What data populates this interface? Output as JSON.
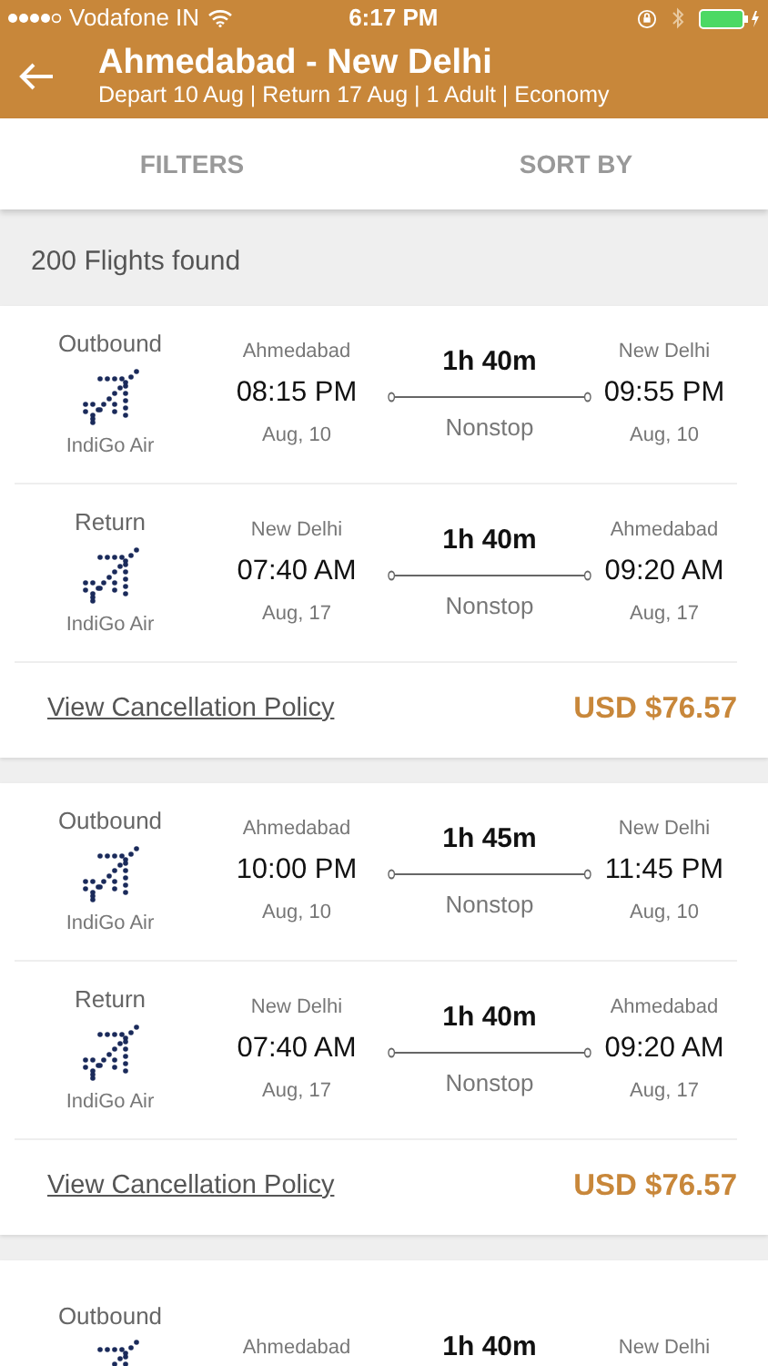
{
  "status_bar": {
    "carrier": "Vodafone IN",
    "time": "6:17 PM"
  },
  "header": {
    "title": "Ahmedabad -  New Delhi",
    "subtitle": "Depart 10 Aug | Return 17 Aug | 1 Adult | Economy"
  },
  "tabs": [
    {
      "label": "FILTERS"
    },
    {
      "label": "SORT BY"
    }
  ],
  "results_count": "200 Flights found",
  "flights": [
    {
      "legs": [
        {
          "label": "Outbound",
          "airline": "IndiGo Air",
          "from_city": "Ahmedabad",
          "depart_time": "08:15 PM",
          "depart_date": "Aug, 10",
          "duration": "1h 40m",
          "stops": "Nonstop",
          "to_city": "New Delhi",
          "arrive_time": "09:55 PM",
          "arrive_date": "Aug, 10"
        },
        {
          "label": "Return",
          "airline": "IndiGo Air",
          "from_city": "New Delhi",
          "depart_time": "07:40 AM",
          "depart_date": "Aug, 17",
          "duration": "1h 40m",
          "stops": "Nonstop",
          "to_city": "Ahmedabad",
          "arrive_time": "09:20 AM",
          "arrive_date": "Aug, 17"
        }
      ],
      "policy_link": "View Cancellation Policy",
      "price": "USD $76.57"
    },
    {
      "legs": [
        {
          "label": "Outbound",
          "airline": "IndiGo Air",
          "from_city": "Ahmedabad",
          "depart_time": "10:00 PM",
          "depart_date": "Aug, 10",
          "duration": "1h 45m",
          "stops": "Nonstop",
          "to_city": "New Delhi",
          "arrive_time": "11:45 PM",
          "arrive_date": "Aug, 10"
        },
        {
          "label": "Return",
          "airline": "IndiGo Air",
          "from_city": "New Delhi",
          "depart_time": "07:40 AM",
          "depart_date": "Aug, 17",
          "duration": "1h 40m",
          "stops": "Nonstop",
          "to_city": "Ahmedabad",
          "arrive_time": "09:20 AM",
          "arrive_date": "Aug, 17"
        }
      ],
      "policy_link": "View Cancellation Policy",
      "price": "USD $76.57"
    },
    {
      "legs": [
        {
          "label": "Outbound",
          "from_city": "Ahmedabad",
          "duration": "1h 40m",
          "to_city": "New Delhi"
        }
      ]
    }
  ]
}
